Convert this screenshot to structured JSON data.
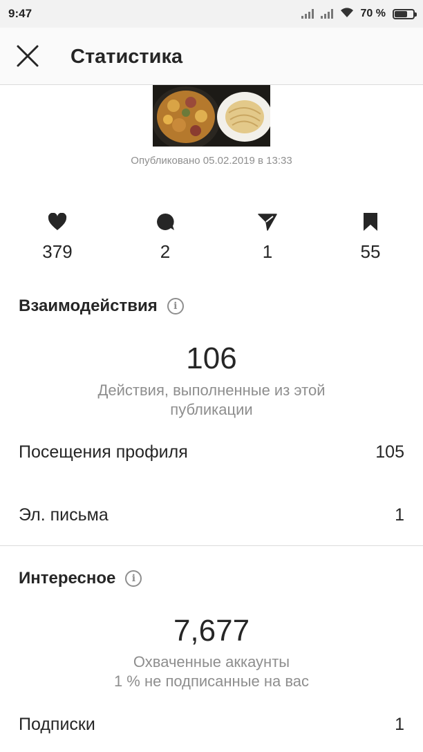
{
  "status_bar": {
    "time": "9:47",
    "battery": "70 %",
    "battery_level": 0.7
  },
  "header": {
    "title": "Статистика",
    "close_icon": "close-icon"
  },
  "post": {
    "published": "Опубликовано 05.02.2019 в 13:33"
  },
  "metrics": [
    {
      "icon": "heart-icon",
      "value": "379"
    },
    {
      "icon": "comment-icon",
      "value": "2"
    },
    {
      "icon": "send-icon",
      "value": "1"
    },
    {
      "icon": "bookmark-icon",
      "value": "55"
    }
  ],
  "interactions": {
    "title": "Взаимодействия",
    "total": "106",
    "description": "Действия, выполненные из этой публикации",
    "rows": [
      {
        "label": "Посещения профиля",
        "value": "105"
      },
      {
        "label": "Эл. письма",
        "value": "1"
      }
    ]
  },
  "discovery": {
    "title": "Интересное",
    "total": "7,677",
    "description_line1": "Охваченные аккаунты",
    "description_line2": "1 % не подписанные на вас",
    "rows": [
      {
        "label": "Подписки",
        "value": "1"
      }
    ]
  },
  "colors": {
    "text": "#262626",
    "secondary": "#8e8e8e",
    "divider": "#dbdbdb"
  }
}
